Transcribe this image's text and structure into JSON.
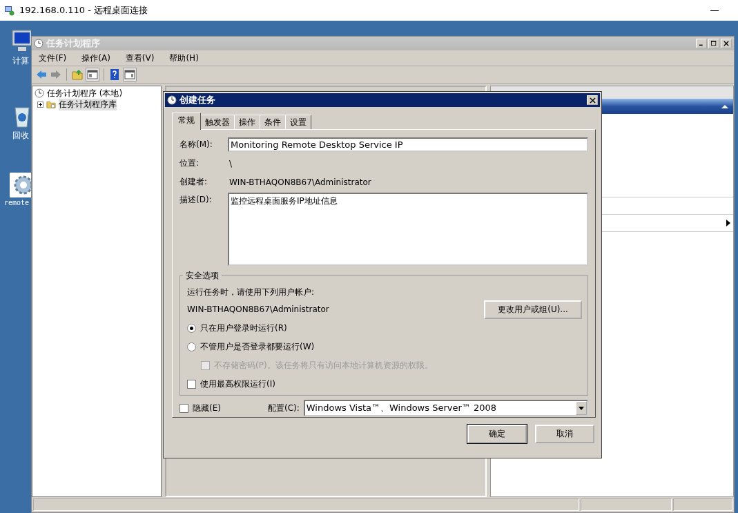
{
  "rdp_window": {
    "title": "192.168.0.110 - 远程桌面连接"
  },
  "desktop_icons": [
    {
      "kind": "computer",
      "label": "计算"
    },
    {
      "kind": "recycle",
      "label": "回收"
    },
    {
      "kind": "gear",
      "label": "remote"
    }
  ],
  "app_window": {
    "title": "任务计划程序"
  },
  "menu": [
    "文件(F)",
    "操作(A)",
    "查看(V)",
    "帮助(H)"
  ],
  "tree": [
    {
      "label": "任务计划程序 (本地)",
      "kind": "clock",
      "selected": false,
      "children": [
        {
          "label": "任务计划程序库",
          "kind": "folder",
          "selected": true,
          "expanded": false
        }
      ]
    }
  ],
  "dialog": {
    "title": "创建任务",
    "tabs": [
      {
        "label": "常规",
        "selected": true
      },
      {
        "label": "触发器",
        "selected": false
      },
      {
        "label": "操作",
        "selected": false
      },
      {
        "label": "条件",
        "selected": false
      },
      {
        "label": "设置",
        "selected": false
      }
    ],
    "name": {
      "label": "名称(M):",
      "value": "Monitoring Remote Desktop Service IP"
    },
    "location": {
      "label": "位置:",
      "value": "\\"
    },
    "author": {
      "label": "创建者:",
      "value": "WIN-BTHAQON8B67\\Administrator"
    },
    "description": {
      "label": "描述(D):",
      "value": "监控远程桌面服务IP地址信息"
    },
    "security": {
      "title": "安全选项",
      "prompt": "运行任务时，请使用下列用户帐户:",
      "account": "WIN-BTHAQON8B67\\Administrator",
      "change_button": "更改用户或组(U)...",
      "options": [
        {
          "kind": "radio",
          "label": "只在用户登录时运行(R)",
          "selected": true,
          "disabled": false
        },
        {
          "kind": "radio",
          "label": "不管用户是否登录都要运行(W)",
          "selected": false,
          "disabled": false
        },
        {
          "kind": "sub-checkbox",
          "label": "不存储密码(P)。该任务将只有访问本地计算机资源的权限。",
          "checked": false,
          "disabled": true
        },
        {
          "kind": "checkbox",
          "label": "使用最高权限运行(I)",
          "checked": false,
          "disabled": false
        }
      ]
    },
    "hidden": {
      "label": "隐藏(E)",
      "checked": false
    },
    "configure": {
      "label": "配置(C):",
      "value": "Windows Vista™、Windows Server™ 2008"
    },
    "buttons": [
      "确定",
      "取消"
    ]
  }
}
